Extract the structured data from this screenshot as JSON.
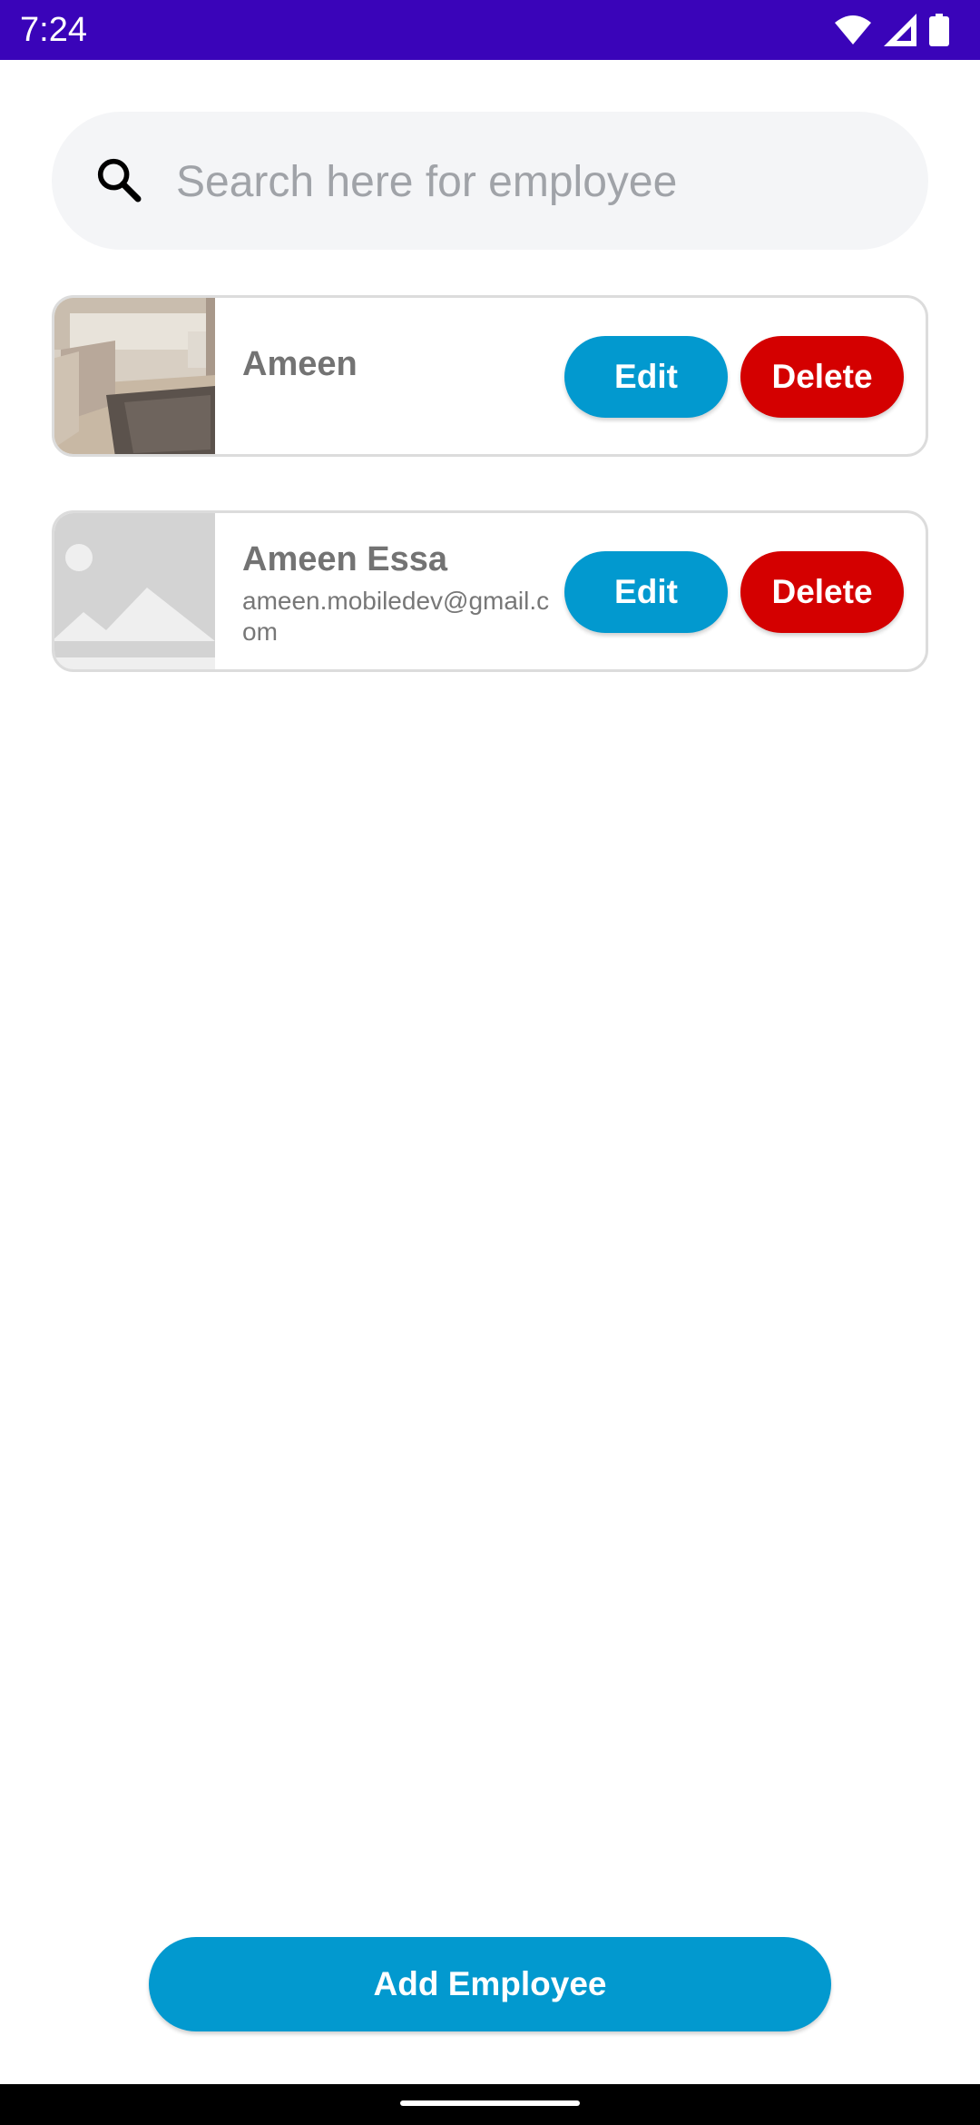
{
  "status_bar": {
    "time": "7:24",
    "icons": [
      "wifi-icon",
      "signal-icon",
      "battery-icon"
    ],
    "color": "#3a04b9"
  },
  "search": {
    "placeholder": "Search here for employee",
    "value": "",
    "icon": "search-icon"
  },
  "employees": [
    {
      "name": "Ameen",
      "email": "",
      "photo": "living-room-photo",
      "edit_label": "Edit",
      "delete_label": "Delete"
    },
    {
      "name": "Ameen Essa",
      "email": "ameen.mobiledev@gmail.com",
      "photo": "image-placeholder-icon",
      "edit_label": "Edit",
      "delete_label": "Delete"
    }
  ],
  "add_button": {
    "label": "Add Employee"
  },
  "colors": {
    "primary": "#0299cf",
    "danger": "#d40000",
    "status_bar": "#3a04b9"
  }
}
